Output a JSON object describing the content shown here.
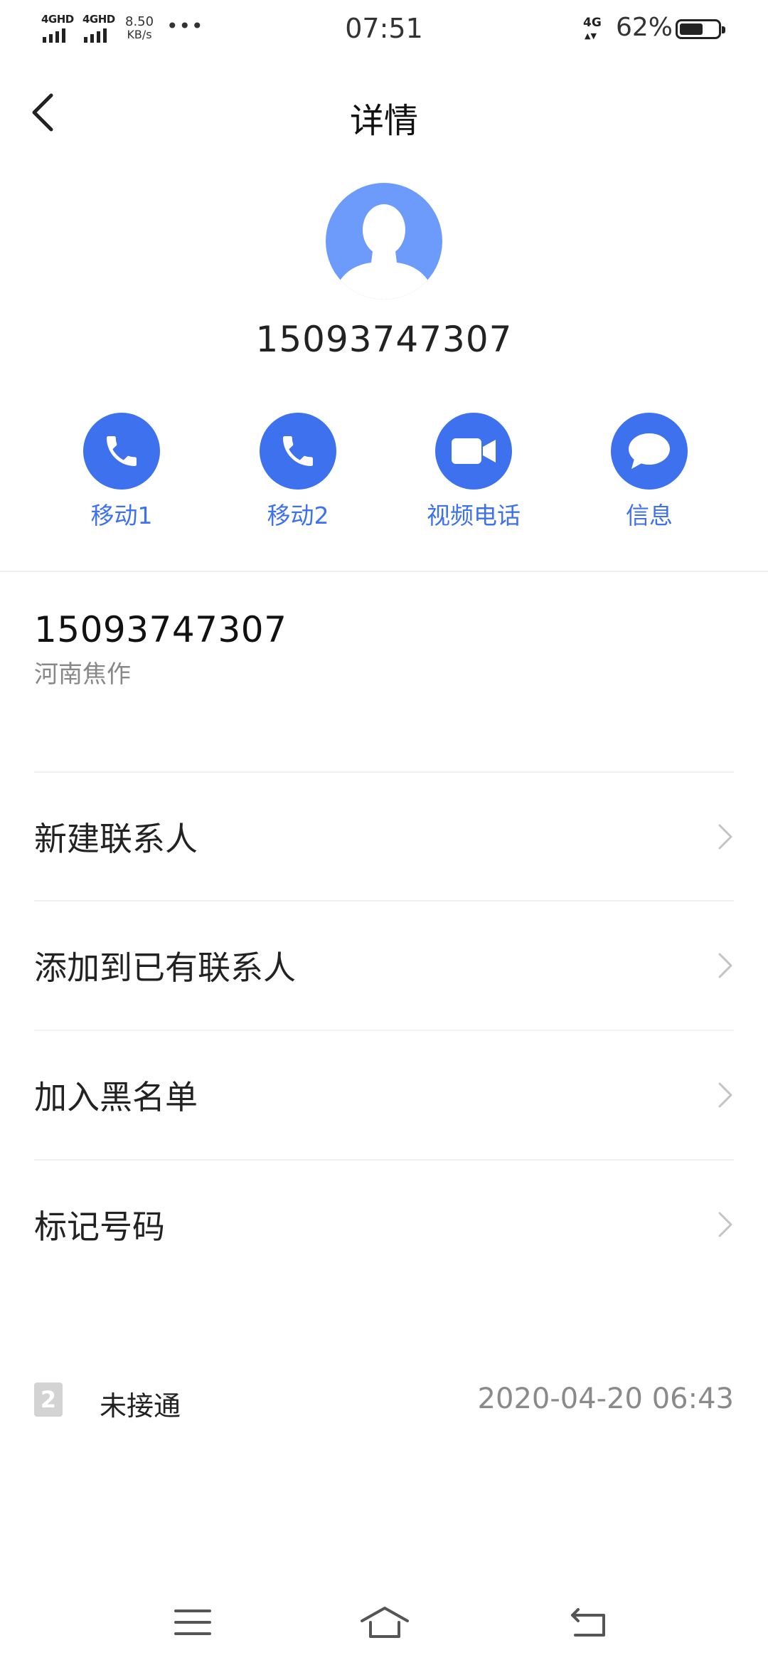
{
  "status_bar": {
    "network1": "4GHD",
    "network2": "4GHD",
    "speed_value": "8.50",
    "speed_unit": "KB/s",
    "more": "•••",
    "time": "07:51",
    "mobile_data": "4G",
    "battery_percent": "62%",
    "battery_level": 0.62
  },
  "header": {
    "title": "详情"
  },
  "contact": {
    "number": "15093747307"
  },
  "actions": [
    {
      "label": "移动1",
      "icon": "phone-icon"
    },
    {
      "label": "移动2",
      "icon": "phone-icon"
    },
    {
      "label": "视频电话",
      "icon": "video-camera-icon"
    },
    {
      "label": "信息",
      "icon": "message-bubble-icon"
    }
  ],
  "number_info": {
    "number": "15093747307",
    "location": "河南焦作"
  },
  "menu": [
    {
      "label": "新建联系人"
    },
    {
      "label": "添加到已有联系人"
    },
    {
      "label": "加入黑名单"
    },
    {
      "label": "标记号码"
    }
  ],
  "call_log": [
    {
      "sim": "2",
      "status": "未接通",
      "time": "2020-04-20 06:43"
    }
  ],
  "colors": {
    "accent": "#3e71ee",
    "avatar": "#6c9bfc"
  }
}
